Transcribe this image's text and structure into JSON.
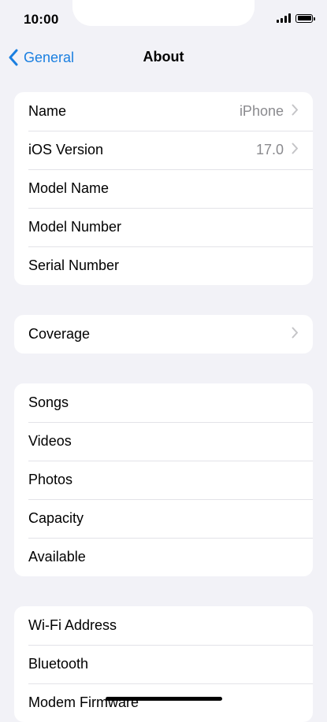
{
  "status_bar": {
    "time": "10:00"
  },
  "nav": {
    "back_label": "General",
    "title": "About"
  },
  "groups": [
    {
      "rows": [
        {
          "label": "Name",
          "value": "iPhone",
          "chevron": true
        },
        {
          "label": "iOS Version",
          "value": "17.0",
          "chevron": true
        },
        {
          "label": "Model Name",
          "value": "",
          "chevron": false
        },
        {
          "label": "Model Number",
          "value": "",
          "chevron": false
        },
        {
          "label": "Serial Number",
          "value": "",
          "chevron": false
        }
      ]
    },
    {
      "rows": [
        {
          "label": "Coverage",
          "value": "",
          "chevron": true
        }
      ]
    },
    {
      "rows": [
        {
          "label": "Songs",
          "value": "",
          "chevron": false
        },
        {
          "label": "Videos",
          "value": "",
          "chevron": false
        },
        {
          "label": "Photos",
          "value": "",
          "chevron": false
        },
        {
          "label": "Capacity",
          "value": "",
          "chevron": false
        },
        {
          "label": "Available",
          "value": "",
          "chevron": false
        }
      ]
    },
    {
      "rows": [
        {
          "label": "Wi-Fi Address",
          "value": "",
          "chevron": false
        },
        {
          "label": "Bluetooth",
          "value": "",
          "chevron": false
        },
        {
          "label": "Modem Firmware",
          "value": "",
          "chevron": false
        }
      ]
    }
  ],
  "colors": {
    "accent": "#1a7fe0",
    "background": "#f2f2f7",
    "secondary_text": "#8a8a8e",
    "separator": "#e3e3e8"
  },
  "icons": {
    "back": "chevron-left-icon",
    "disclosure": "chevron-right-icon",
    "signal": "cellular-signal-icon",
    "battery": "battery-icon"
  }
}
